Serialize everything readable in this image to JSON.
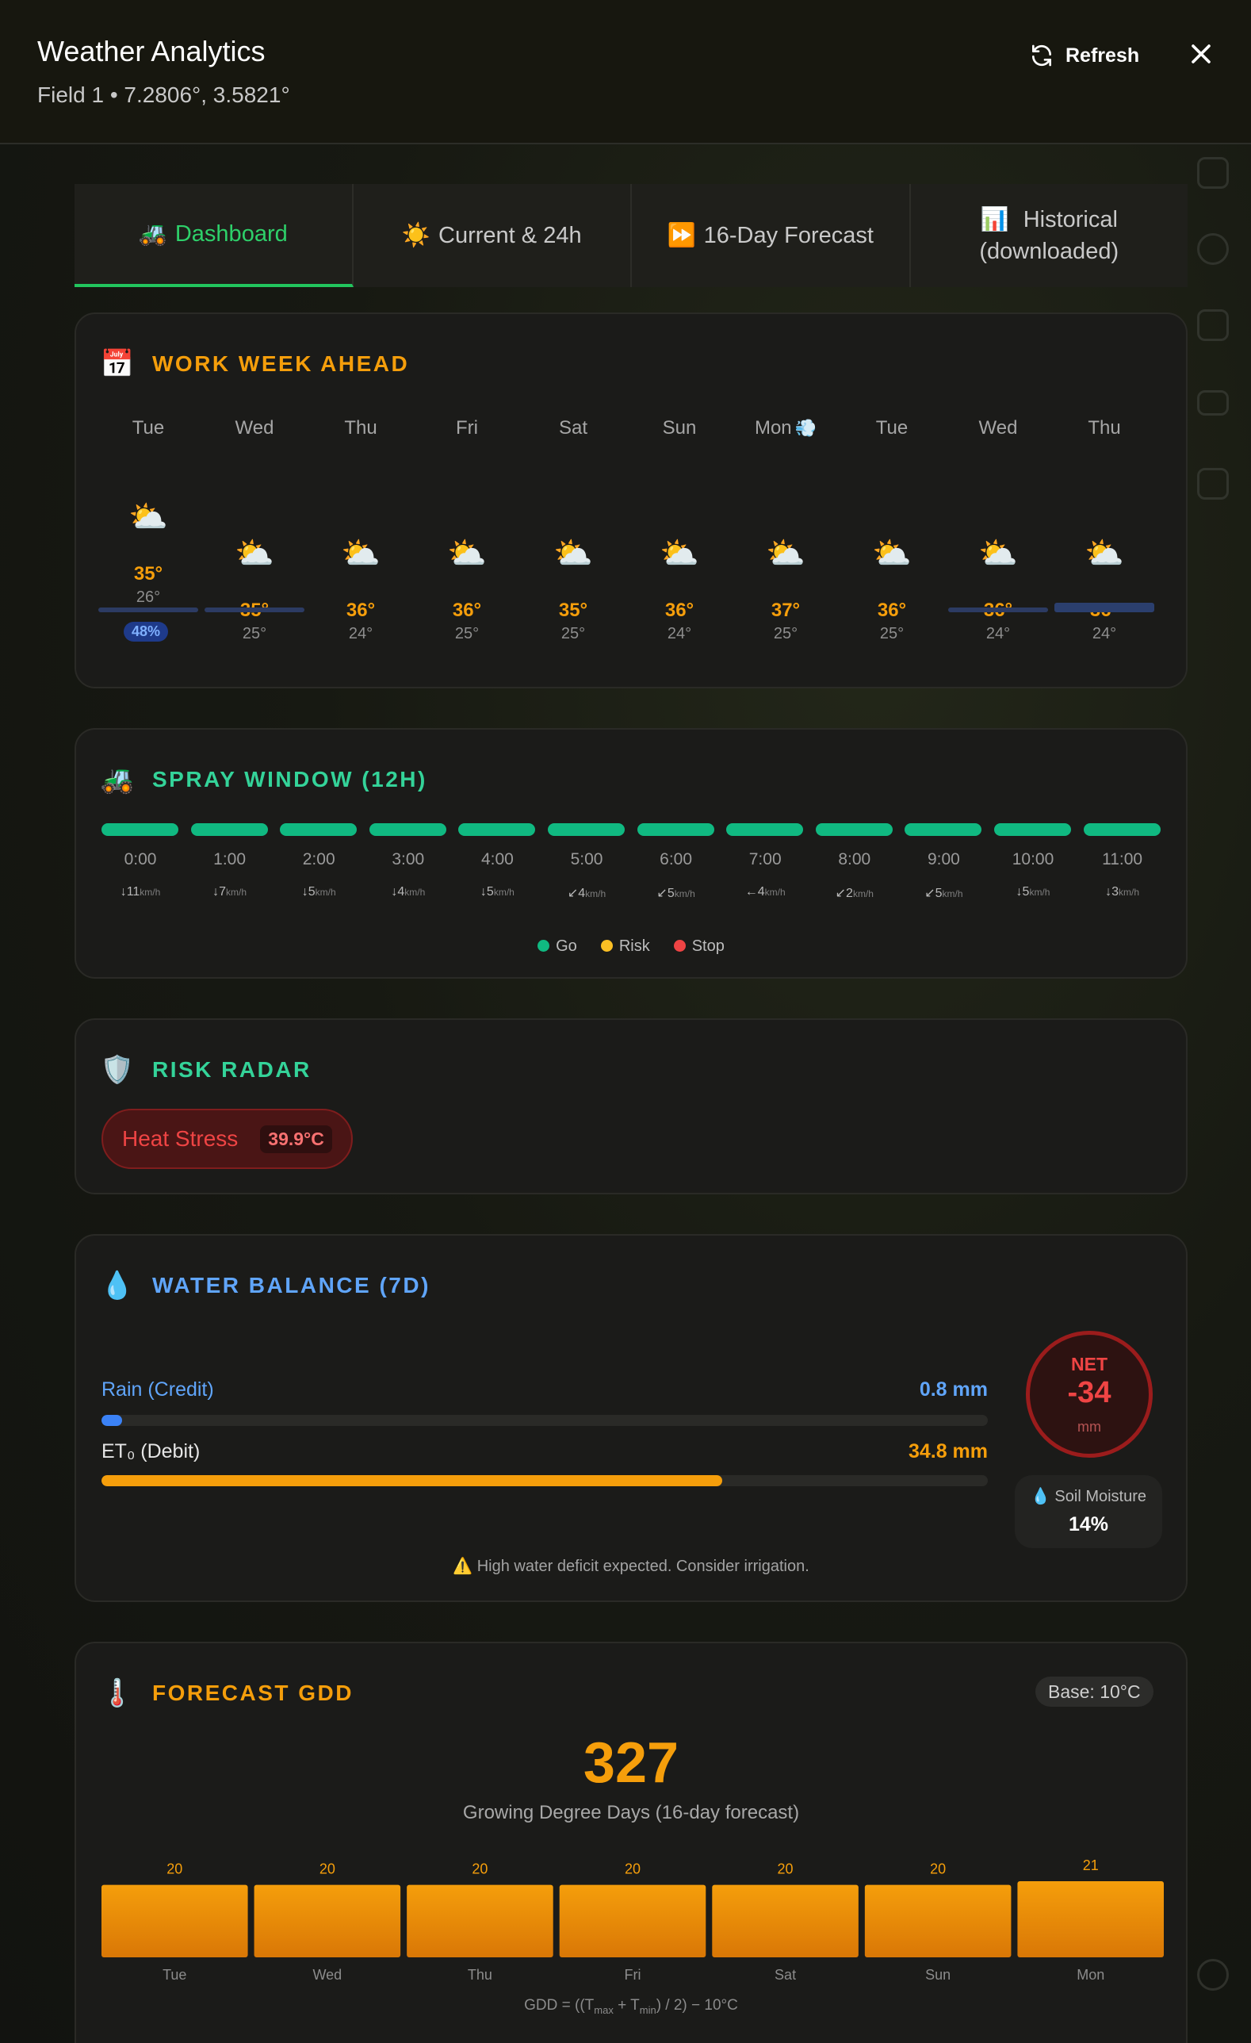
{
  "header": {
    "title": "Weather Analytics",
    "subtitle": "Field 1 • 7.2806°, 3.5821°",
    "refresh_label": "Refresh"
  },
  "tabs": [
    {
      "icon": "🚜",
      "label": "Dashboard",
      "active": true
    },
    {
      "icon": "☀️",
      "label": "Current & 24h",
      "active": false
    },
    {
      "icon": "⏩",
      "label": "16-Day Forecast",
      "active": false
    },
    {
      "icon": "📊",
      "label": "Historical (downloaded)",
      "active": false
    }
  ],
  "work_week": {
    "title": "WORK WEEK AHEAD",
    "days": [
      {
        "day": "Tue",
        "icon": "⛅",
        "hi": "35°",
        "lo": "26°",
        "precip": "48%",
        "precip_level": 1.0
      },
      {
        "day": "Wed",
        "icon": "⛅",
        "hi": "35°",
        "lo": "25°",
        "precip_level": 1.0
      },
      {
        "day": "Thu",
        "icon": "⛅",
        "hi": "36°",
        "lo": "24°"
      },
      {
        "day": "Fri",
        "icon": "⛅",
        "hi": "36°",
        "lo": "25°"
      },
      {
        "day": "Sat",
        "icon": "⛅",
        "hi": "35°",
        "lo": "25°"
      },
      {
        "day": "Sun",
        "icon": "⛅",
        "hi": "36°",
        "lo": "24°"
      },
      {
        "day": "Mon",
        "extra_icon": "💨",
        "icon": "⛅",
        "hi": "37°",
        "lo": "25°"
      },
      {
        "day": "Tue",
        "icon": "⛅",
        "hi": "36°",
        "lo": "25°"
      },
      {
        "day": "Wed",
        "icon": "⛅",
        "hi": "36°",
        "lo": "24°",
        "precip_level": 1.0
      },
      {
        "day": "Thu",
        "icon": "⛅",
        "hi": "36°",
        "lo": "24°",
        "precip_level": 1.0
      }
    ]
  },
  "spray": {
    "title": "SPRAY WINDOW (12H)",
    "status_color": "#10b981",
    "hours": [
      {
        "time": "0:00",
        "arrow": "↓",
        "speed": "11",
        "unit": "km/h"
      },
      {
        "time": "1:00",
        "arrow": "↓",
        "speed": "7",
        "unit": "km/h"
      },
      {
        "time": "2:00",
        "arrow": "↓",
        "speed": "5",
        "unit": "km/h"
      },
      {
        "time": "3:00",
        "arrow": "↓",
        "speed": "4",
        "unit": "km/h"
      },
      {
        "time": "4:00",
        "arrow": "↓",
        "speed": "5",
        "unit": "km/h"
      },
      {
        "time": "5:00",
        "arrow": "↙",
        "speed": "4",
        "unit": "km/h"
      },
      {
        "time": "6:00",
        "arrow": "↙",
        "speed": "5",
        "unit": "km/h"
      },
      {
        "time": "7:00",
        "arrow": "←",
        "speed": "4",
        "unit": "km/h"
      },
      {
        "time": "8:00",
        "arrow": "↙",
        "speed": "2",
        "unit": "km/h"
      },
      {
        "time": "9:00",
        "arrow": "↙",
        "speed": "5",
        "unit": "km/h"
      },
      {
        "time": "10:00",
        "arrow": "↓",
        "speed": "5",
        "unit": "km/h"
      },
      {
        "time": "11:00",
        "arrow": "↓",
        "speed": "3",
        "unit": "km/h"
      }
    ],
    "legend": [
      {
        "label": "Go",
        "color": "#10b981"
      },
      {
        "label": "Risk",
        "color": "#fbbf24"
      },
      {
        "label": "Stop",
        "color": "#ef4444"
      }
    ]
  },
  "risk": {
    "title": "RISK RADAR",
    "label": "Heat Stress",
    "value": "39.9°C"
  },
  "water": {
    "title": "WATER BALANCE (7D)",
    "rain_label": "Rain (Credit)",
    "rain_value": "0.8 mm",
    "rain_fraction": 0.023,
    "et_label": "ET₀ (Debit)",
    "et_value": "34.8 mm",
    "et_fraction": 0.7,
    "net_label": "NET",
    "net_value": "-34",
    "net_unit": "mm",
    "soil_label": "Soil Moisture",
    "soil_value": "14%",
    "warning": "High water deficit expected. Consider irrigation."
  },
  "gdd": {
    "title": "FORECAST GDD",
    "base": "Base: 10°C",
    "total": "327",
    "caption": "Growing Degree Days (16-day forecast)",
    "formula_prefix": "GDD = ((T",
    "formula_max": "max",
    "formula_mid": " + T",
    "formula_min": "min",
    "formula_suffix": ") / 2) − 10°C"
  },
  "chart_data": {
    "type": "bar",
    "categories": [
      "Tue",
      "Wed",
      "Thu",
      "Fri",
      "Sat",
      "Sun",
      "Mon"
    ],
    "values": [
      20,
      20,
      20,
      20,
      20,
      20,
      21
    ],
    "title": "",
    "xlabel": "",
    "ylabel": "",
    "ylim": [
      0,
      21
    ]
  }
}
